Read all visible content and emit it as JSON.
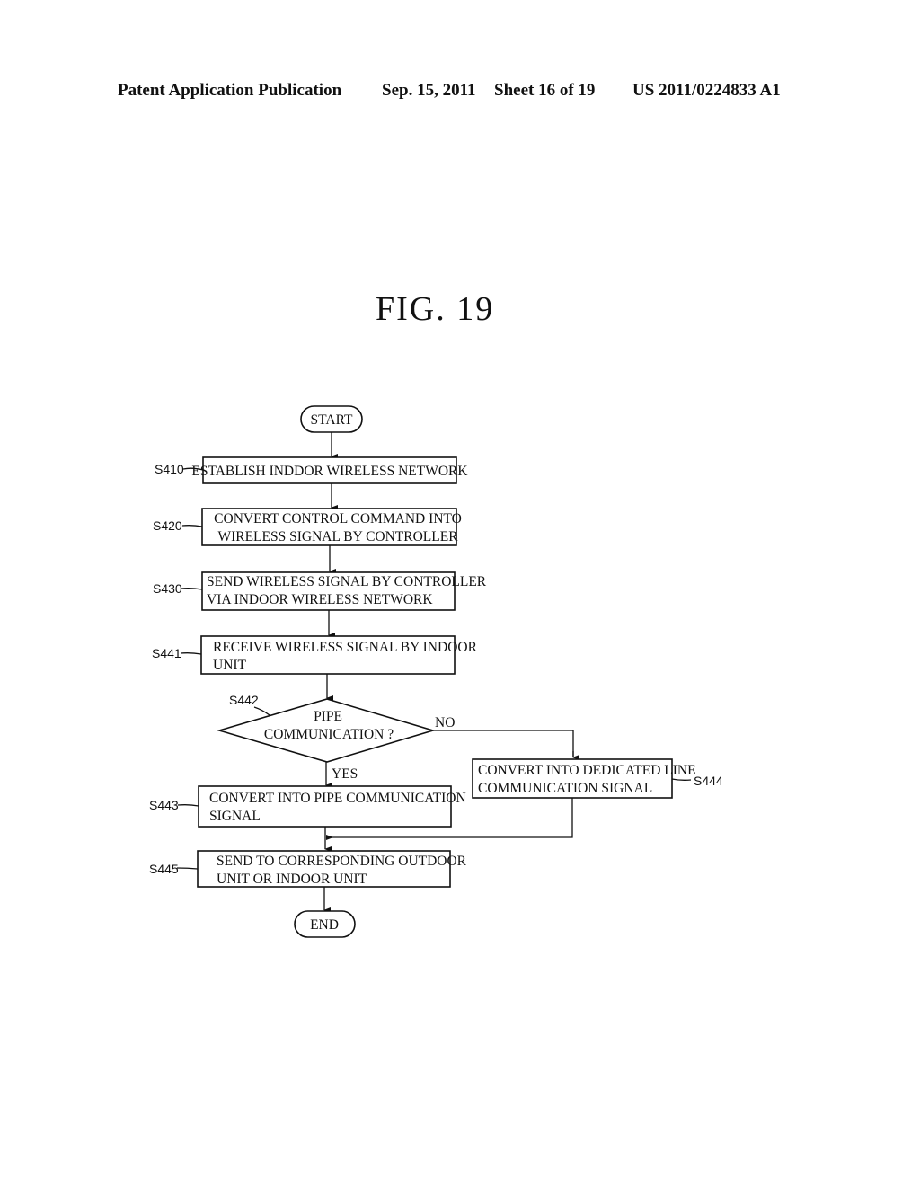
{
  "header": {
    "publication": "Patent Application Publication",
    "date": "Sep. 15, 2011",
    "sheet": "Sheet 16 of 19",
    "number": "US 2011/0224833 A1"
  },
  "figure": {
    "title": "FIG.  19"
  },
  "flowchart": {
    "start": "START",
    "end": "END",
    "steps": [
      {
        "id": "S410",
        "lines": [
          "ESTABLISH INDDOR WIRELESS NETWORK"
        ]
      },
      {
        "id": "S420",
        "lines": [
          "CONVERT CONTROL COMMAND INTO",
          "WIRELESS SIGNAL BY CONTROLLER"
        ]
      },
      {
        "id": "S430",
        "lines": [
          "SEND WIRELESS SIGNAL BY CONTROLLER",
          "VIA INDOOR WIRELESS NETWORK"
        ]
      },
      {
        "id": "S441",
        "lines": [
          "RECEIVE WIRELESS SIGNAL BY INDOOR",
          "UNIT"
        ]
      },
      {
        "id": "S443",
        "lines": [
          "CONVERT INTO PIPE COMMUNICATION",
          "SIGNAL"
        ]
      },
      {
        "id": "S444",
        "lines": [
          "CONVERT INTO DEDICATED LINE",
          "COMMUNICATION SIGNAL"
        ]
      },
      {
        "id": "S445",
        "lines": [
          "SEND TO CORRESPONDING OUTDOOR",
          "UNIT OR INDOOR UNIT"
        ]
      }
    ],
    "decision": {
      "id": "S442",
      "lines": [
        "PIPE",
        "COMMUNICATION ?"
      ],
      "yes_label": "YES",
      "no_label": "NO"
    }
  }
}
